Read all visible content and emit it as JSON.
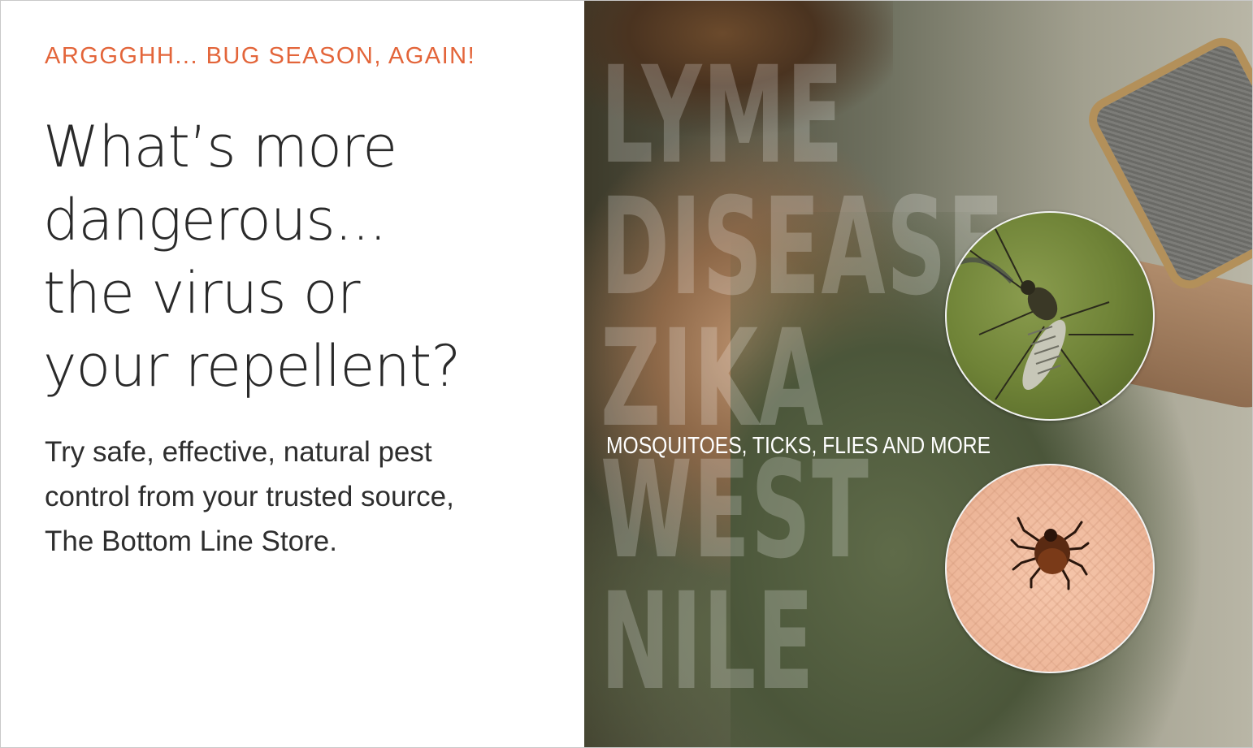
{
  "ad": {
    "eyebrow": "ARGGGHH... BUG SEASON, AGAIN!",
    "headline_lines": [
      "What’s more",
      "dangerous...",
      "the virus or",
      "your repellent?"
    ],
    "body_lines": [
      "Try safe, effective, natural pest",
      "control from your trusted source,",
      "The Bottom Line Store."
    ]
  },
  "image": {
    "watermark_lines": [
      "LYME",
      "DISEASE",
      "ZIKA",
      "WEST",
      "NILE"
    ],
    "caption": "MOSQUITOES, TICKS, FLIES AND MORE",
    "inset_1": "mosquito-photo",
    "inset_2": "tick-photo"
  },
  "colors": {
    "accent": "#e3653a",
    "headline": "#2a2a2a",
    "body": "#2e2e2e",
    "frame_border": "#c9c9c9"
  }
}
